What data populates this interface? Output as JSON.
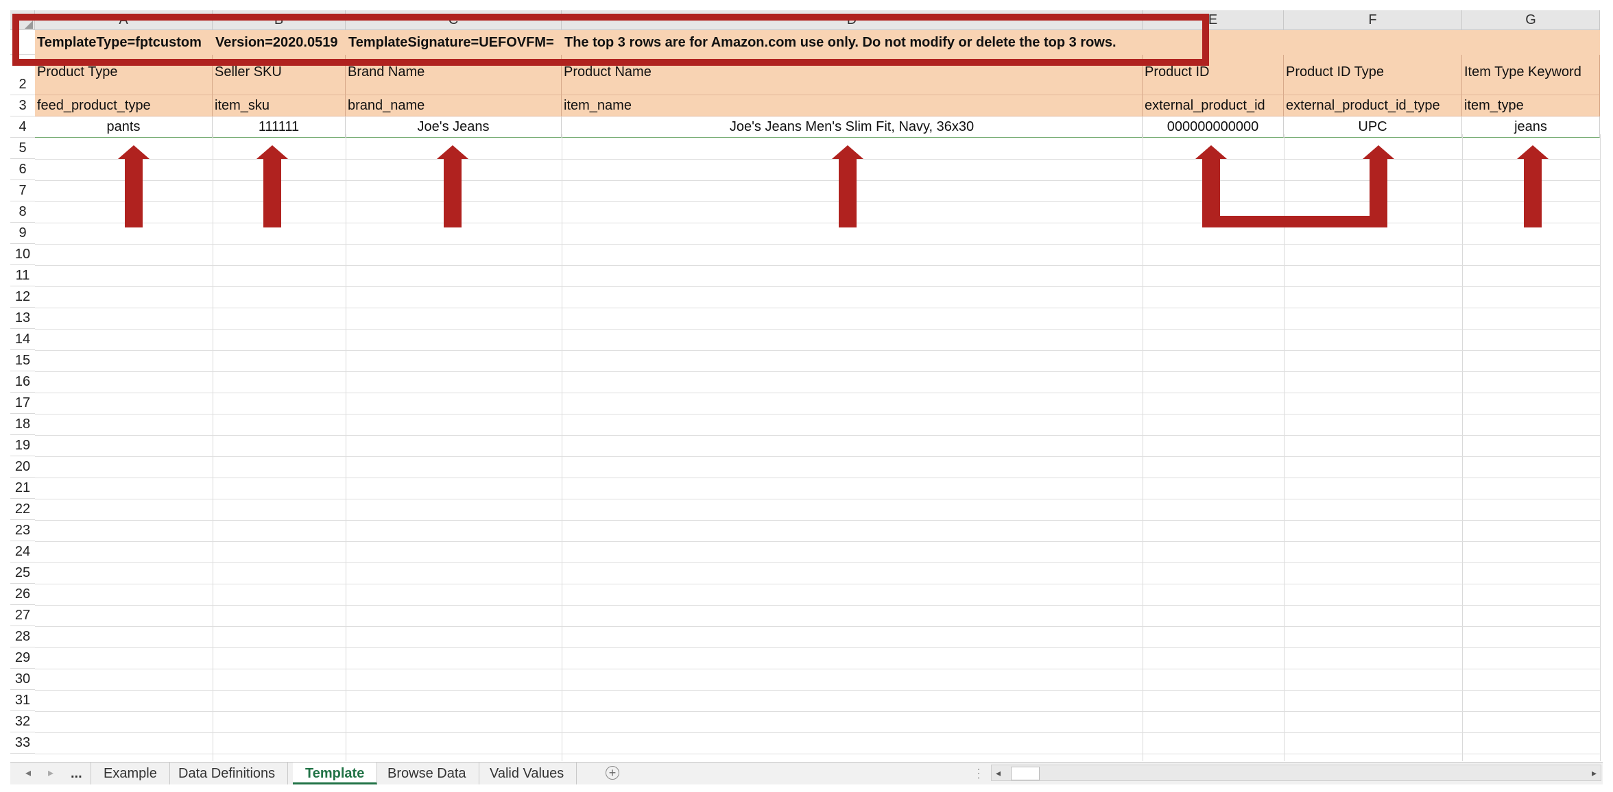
{
  "columns": [
    "A",
    "B",
    "C",
    "D",
    "E",
    "F",
    "G"
  ],
  "row_numbers": [
    "2",
    "3",
    "4",
    "5",
    "6",
    "7",
    "8",
    "9",
    "10",
    "11",
    "12",
    "13",
    "14",
    "15",
    "16",
    "17",
    "18",
    "19",
    "20",
    "21",
    "22",
    "23",
    "24",
    "25",
    "26",
    "27",
    "28",
    "29",
    "30",
    "31",
    "32",
    "33"
  ],
  "row1": {
    "c1": "TemplateType=fptcustom",
    "c2": "Version=2020.0519",
    "c3": "TemplateSignature=UEFOVFM=",
    "c4": "The top 3 rows are for Amazon.com use only. Do not modify or delete the top 3 rows."
  },
  "row2": [
    "Product Type",
    "Seller SKU",
    "Brand Name",
    "Product Name",
    "Product ID",
    "Product ID Type",
    "Item Type Keyword"
  ],
  "row3": [
    "feed_product_type",
    "item_sku",
    "brand_name",
    "item_name",
    "external_product_id",
    "external_product_id_type",
    "item_type"
  ],
  "row4": [
    "pants",
    "111111",
    "Joe's Jeans",
    "Joe's Jeans Men's Slim Fit, Navy, 36x30",
    "000000000000",
    "UPC",
    "jeans"
  ],
  "tabs": {
    "ellipsis": "...",
    "items": [
      "Example",
      "Data Definitions",
      "Template",
      "Browse Data",
      "Valid Values"
    ],
    "active": "Template"
  },
  "colors": {
    "header_fill": "#f8d3b3",
    "annotation_red": "#b0221f",
    "active_tab": "#217346"
  },
  "icons": [
    "prev-sheet-icon",
    "next-sheet-icon",
    "add-sheet-icon",
    "scroll-left-icon",
    "scroll-right-icon"
  ]
}
